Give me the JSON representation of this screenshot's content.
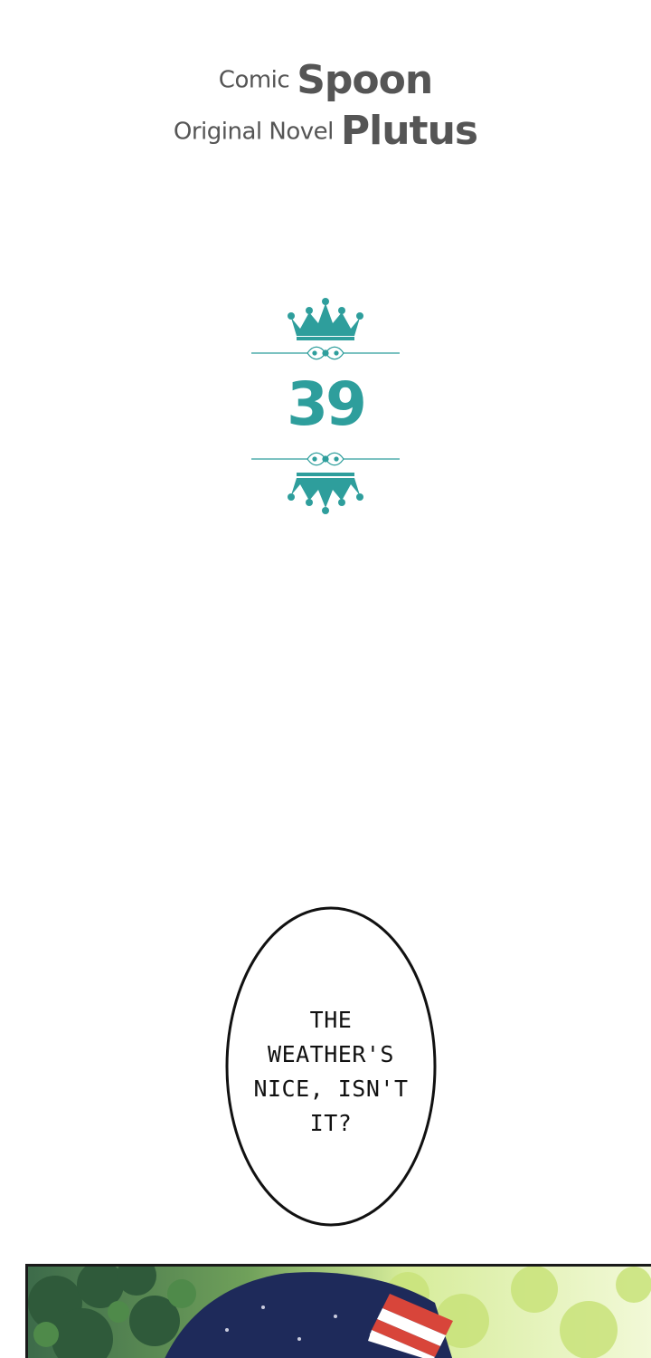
{
  "credits": {
    "comic_role": "Comic",
    "comic_name": "Spoon",
    "novel_role": "Original Novel",
    "novel_name": "Plutus"
  },
  "chapter": {
    "number": "39"
  },
  "speech_bubble": {
    "text": "THE\nWEATHER'S\nNICE, ISN'T\nIT?"
  },
  "colors": {
    "accent_teal": "#2e9e9c",
    "credit_gray": "#555555"
  },
  "icons": {
    "top_ornament": "crown-icon",
    "bottom_ornament": "inverted-crown-icon"
  }
}
